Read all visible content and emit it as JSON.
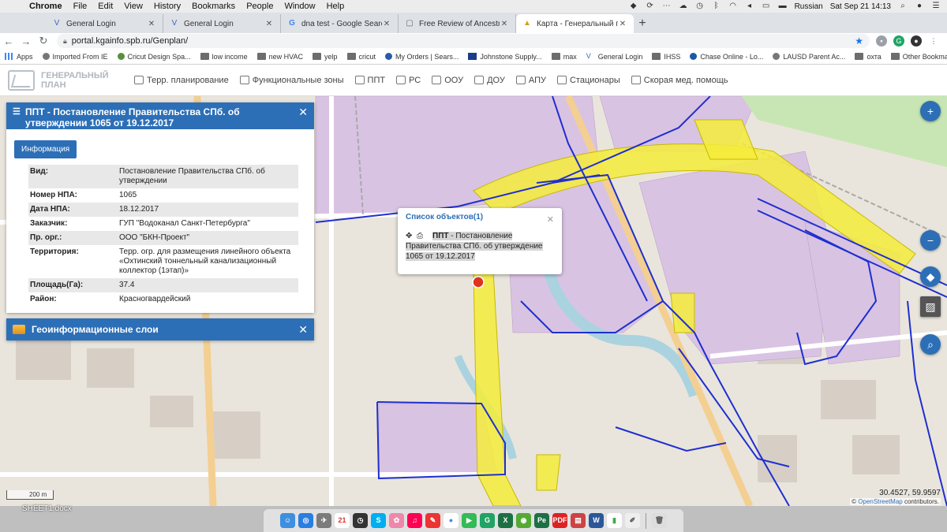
{
  "menubar": {
    "app": "Chrome",
    "items": [
      "File",
      "Edit",
      "View",
      "History",
      "Bookmarks",
      "People",
      "Window",
      "Help"
    ],
    "language": "Russian",
    "datetime": "Sat Sep 21  14:13"
  },
  "tabs": [
    {
      "label": "General Login",
      "icon": "v-favicon"
    },
    {
      "label": "General Login",
      "icon": "v-favicon"
    },
    {
      "label": "dna test - Google Search",
      "icon": "google-favicon"
    },
    {
      "label": "Free Review of Ancestry Dna T",
      "icon": "doc-favicon"
    },
    {
      "label": "Карта - Генеральный план Са",
      "icon": "genplan-favicon",
      "active": true
    }
  ],
  "url": "portal.kgainfo.spb.ru/Genplan/",
  "bookmarks": [
    {
      "label": "Apps"
    },
    {
      "label": "Imported From IE"
    },
    {
      "label": "Cricut Design Spa..."
    },
    {
      "label": "low income"
    },
    {
      "label": "new HVAC"
    },
    {
      "label": "yelp"
    },
    {
      "label": "cricut"
    },
    {
      "label": "My Orders | Sears..."
    },
    {
      "label": "Johnstone Supply..."
    },
    {
      "label": "max"
    },
    {
      "label": "General Login"
    },
    {
      "label": "IHSS"
    },
    {
      "label": "Chase Online - Lo..."
    },
    {
      "label": "LAUSD Parent Ac..."
    },
    {
      "label": "охта"
    }
  ],
  "other_bookmarks": "Other Bookmarks",
  "app": {
    "logo_line1": "ГЕНЕРАЛЬНЫЙ",
    "logo_line2": "ПЛАН",
    "menu": [
      "Терр. планирование",
      "Функциональные зоны",
      "ППТ",
      "РС",
      "ООУ",
      "ДОУ",
      "АПУ",
      "Стационары",
      "Скорая мед. помощь"
    ]
  },
  "panel": {
    "title": "ППТ - Постановление Правительства СПб. об утверждении 1065 от 19.12.2017",
    "info_button": "Информация",
    "rows": [
      {
        "k": "Вид:",
        "v": "Постановление Правительства СПб. об утверждении"
      },
      {
        "k": "Номер НПА:",
        "v": "1065"
      },
      {
        "k": "Дата НПА:",
        "v": "18.12.2017"
      },
      {
        "k": "Заказчик:",
        "v": "ГУП \"Водоканал Санкт-Петербурга\""
      },
      {
        "k": "Пр. орг.:",
        "v": "ООО \"БКН-Проект\""
      },
      {
        "k": "Территория:",
        "v": "Терр. огр. для размещения линейного объекта «Охтинский тоннельный канализационный коллектор (1этап)»"
      },
      {
        "k": "Площадь(Га):",
        "v": "37.4"
      },
      {
        "k": "Район:",
        "v": "Красногвардейский"
      }
    ]
  },
  "layers_panel": {
    "title": "Геоинформационные слои"
  },
  "popup": {
    "title": "Список объектов(1)",
    "bold": "ППТ",
    "text": " - Постановление Правительства СПб. об утверждение 1065 от 19.12.2017"
  },
  "map": {
    "scale": "200 m",
    "coords": "30.4527, 59.9597",
    "attribution_prefix": "© ",
    "attribution_link": "OpenStreetMap",
    "attribution_suffix": " contributors."
  },
  "desktop_file": "SHEET1.docx",
  "colors": {
    "accent": "#2c6fb7",
    "highlight_yellow": "#f4ec3a",
    "boundary_blue": "#1f2fd0",
    "zone_purple": "#d9c3e3"
  }
}
